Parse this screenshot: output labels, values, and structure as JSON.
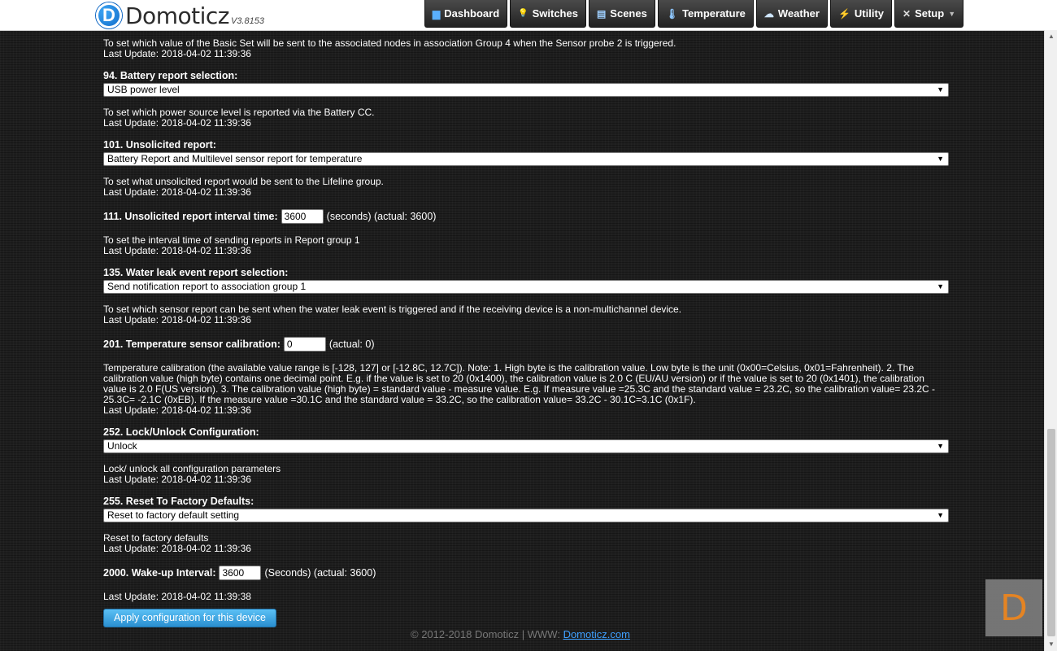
{
  "header": {
    "logo_letter": "D",
    "app_name": "Domoticz",
    "version": "V3.8153",
    "nav": [
      {
        "label": "Dashboard",
        "icon": "▆"
      },
      {
        "label": "Switches",
        "icon": "💡"
      },
      {
        "label": "Scenes",
        "icon": "▤"
      },
      {
        "label": "Temperature",
        "icon": "🌡"
      },
      {
        "label": "Weather",
        "icon": "☁"
      },
      {
        "label": "Utility",
        "icon": "⚡"
      },
      {
        "label": "Setup",
        "icon": "✕"
      }
    ]
  },
  "top": {
    "description": "To set which value of the Basic Set will be sent to the associated nodes in association Group 4 when the Sensor probe 2 is triggered.",
    "last_update": "Last Update: 2018-04-02 11:39:36"
  },
  "p94": {
    "label": "94. Battery report selection:",
    "selected": "USB power level",
    "description": "To set which power source level is reported via the Battery CC.",
    "last_update": "Last Update: 2018-04-02 11:39:36"
  },
  "p101": {
    "label": "101. Unsolicited report:",
    "selected": "Battery Report and Multilevel sensor report for temperature",
    "description": "To set what unsolicited report would be sent to the Lifeline group.",
    "last_update": "Last Update: 2018-04-02 11:39:36"
  },
  "p111": {
    "label": "111. Unsolicited report interval time:",
    "value": "3600",
    "suffix": "(seconds) (actual: 3600)",
    "description": "To set the interval time of sending reports in Report group 1",
    "last_update": "Last Update: 2018-04-02 11:39:36"
  },
  "p135": {
    "label": "135. Water leak event report selection:",
    "selected": "Send notification report to association group 1",
    "description": "To set which sensor report can be sent when the water leak event is triggered and if the receiving device is a non-multichannel device.",
    "last_update": "Last Update: 2018-04-02 11:39:36"
  },
  "p201": {
    "label": "201. Temperature sensor calibration:",
    "value": "0",
    "suffix": "(actual: 0)",
    "description": "Temperature calibration (the available value range is [-128, 127] or [-12.8C, 12.7C]). Note: 1. High byte is the calibration value. Low byte is the unit (0x00=Celsius, 0x01=Fahrenheit). 2. The calibration value (high byte) contains one decimal point. E.g. if the value is set to 20 (0x1400), the calibration value is 2.0 C (EU/AU version) or if the value is set to 20 (0x1401), the calibration value is 2.0 F(US version). 3. The calibration value (high byte) = standard value - measure value. E.g. If measure value =25.3C and the standard value = 23.2C, so the calibration value= 23.2C - 25.3C= -2.1C (0xEB). If the measure value =30.1C and the standard value = 33.2C, so the calibration value= 33.2C - 30.1C=3.1C (0x1F).",
    "last_update": "Last Update: 2018-04-02 11:39:36"
  },
  "p252": {
    "label": "252. Lock/Unlock Configuration:",
    "selected": "Unlock",
    "description": "Lock/ unlock all configuration parameters",
    "last_update": "Last Update: 2018-04-02 11:39:36"
  },
  "p255": {
    "label": "255. Reset To Factory Defaults:",
    "selected": "Reset to factory default setting",
    "description": "Reset to factory defaults",
    "last_update": "Last Update: 2018-04-02 11:39:36"
  },
  "p2000": {
    "label": "2000. Wake-up Interval:",
    "value": "3600",
    "suffix": "(Seconds) (actual: 3600)",
    "last_update": "Last Update: 2018-04-02 11:39:38"
  },
  "apply_label": "Apply configuration for this device",
  "footer": {
    "text": "© 2012-2018 Domoticz | WWW:",
    "link": "Domoticz.com"
  },
  "watermark_letter": "D"
}
